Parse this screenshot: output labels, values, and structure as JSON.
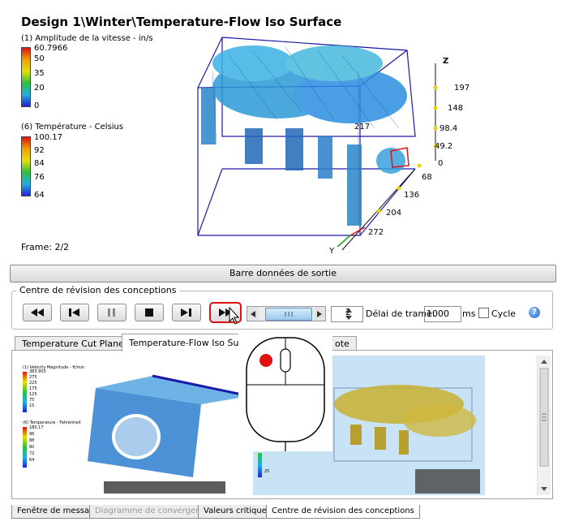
{
  "viewport": {
    "title": "Design 1\\Winter\\Temperature-Flow Iso Surface",
    "legend1": {
      "title": "(1) Amplitude de la vitesse - in/s",
      "ticks": [
        "60.7966",
        "50",
        "35",
        "20",
        "0"
      ]
    },
    "legend2": {
      "title": "(6) Température - Celsius",
      "ticks": [
        "100.17",
        "92",
        "84",
        "76",
        "64"
      ]
    },
    "axis_z": "Z",
    "axis_y": "Y",
    "z_ticks": [
      "197",
      "148",
      "98.4",
      "49.2",
      "0"
    ],
    "x_ticks": [
      "217",
      "68",
      "136",
      "204",
      "272"
    ],
    "frame": "Frame: 2/2"
  },
  "output_bar": {
    "label": "Barre données de sortie"
  },
  "review": {
    "group_title": "Centre de révision des conceptions",
    "frame_value": "2",
    "delay_label": "Délai de trame:",
    "delay_value": "1000",
    "ms_label": "ms",
    "cycle_label": "Cycle",
    "help": "?"
  },
  "tabs": [
    {
      "label": "Temperature Cut Plane"
    },
    {
      "label": "Temperature-Flow Iso Surfa"
    },
    {
      "label": "ote"
    }
  ],
  "thumbnails": {
    "left_legend1": "(1) Velocity Magnitude - ft/min",
    "left_legend1_ticks": [
      "383.903",
      "275",
      "225",
      "175",
      "125",
      "75",
      "15"
    ],
    "left_legend2": "(6) Temperature - Fahrenheit",
    "left_legend2_ticks": [
      "180.17",
      "96",
      "88",
      "80",
      "72",
      "64"
    ],
    "right_legend_tick": "25"
  },
  "bottom_tabs": [
    {
      "label": "Fenêtre de message"
    },
    {
      "label": "Diagramme de convergence"
    },
    {
      "label": "Valeurs critiques"
    },
    {
      "label": "Centre de révision des conceptions"
    }
  ],
  "colors": {
    "accent_blue": "#2a7de1",
    "highlight_red": "#e01010",
    "frame_box": "#1a1aa8"
  }
}
